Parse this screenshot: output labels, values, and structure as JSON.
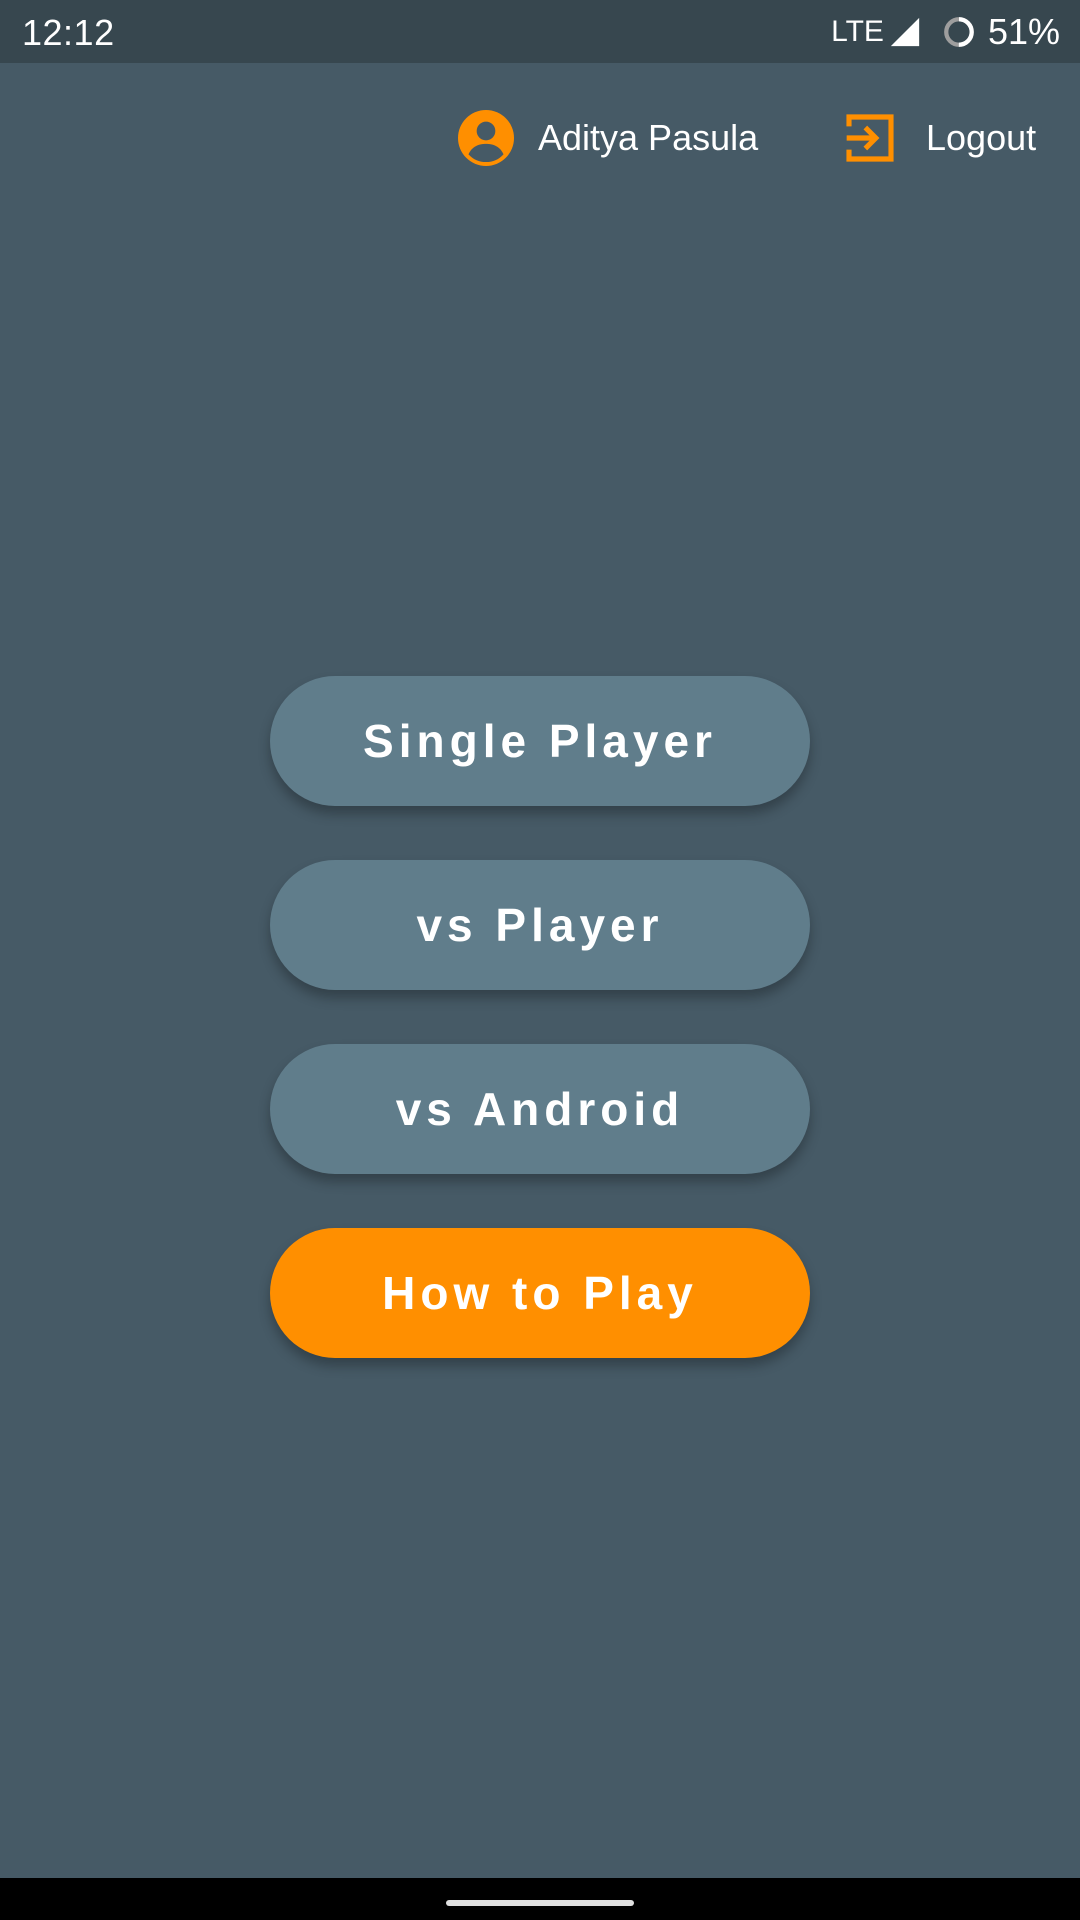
{
  "status_bar": {
    "time": "12:12",
    "network": "LTE",
    "battery": "51%",
    "icons": [
      "signal-icon",
      "battery-icon"
    ]
  },
  "header": {
    "user_name": "Aditya Pasula",
    "user_icon": "account-circle-icon",
    "logout_label": "Logout",
    "logout_icon": "logout-icon"
  },
  "menu": {
    "buttons": [
      {
        "label": "Single Player"
      },
      {
        "label": "vs Player"
      },
      {
        "label": "vs Android"
      },
      {
        "label": "How to Play"
      }
    ]
  },
  "colors": {
    "background": "#465a66",
    "status_bar": "#37474f",
    "button": "#607d8b",
    "accent": "#ff8f00",
    "text": "#ffffff"
  }
}
